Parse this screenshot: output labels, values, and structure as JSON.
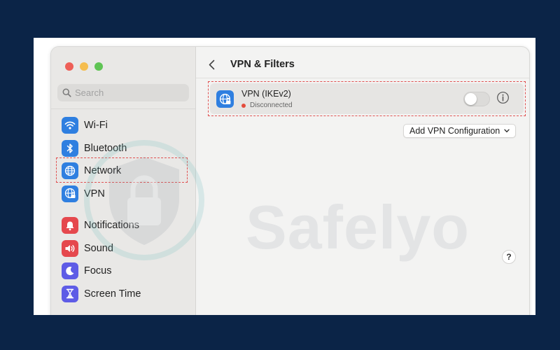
{
  "sidebar": {
    "search_placeholder": "Search",
    "items": [
      {
        "label": "Wi-Fi",
        "icon": "wifi-icon",
        "color": "#2f7fe0"
      },
      {
        "label": "Bluetooth",
        "icon": "bluetooth-icon",
        "color": "#2f7fe0"
      },
      {
        "label": "Network",
        "icon": "globe-icon",
        "color": "#2f7fe0"
      },
      {
        "label": "VPN",
        "icon": "globe-lock-icon",
        "color": "#2f7fe0"
      },
      {
        "label": "Notifications",
        "icon": "bell-icon",
        "color": "#e5484d"
      },
      {
        "label": "Sound",
        "icon": "speaker-icon",
        "color": "#e5484d"
      },
      {
        "label": "Focus",
        "icon": "moon-icon",
        "color": "#5e5ce6"
      },
      {
        "label": "Screen Time",
        "icon": "hourglass-icon",
        "color": "#5e5ce6"
      }
    ]
  },
  "main": {
    "title": "VPN & Filters",
    "vpn": {
      "name": "VPN (IKEv2)",
      "status": "Disconnected",
      "status_color": "#e44c3c",
      "enabled": false
    },
    "add_button_label": "Add VPN Configuration",
    "help_label": "?"
  },
  "watermark": {
    "text": "Safelyo"
  },
  "colors": {
    "page_background": "#0b2447",
    "highlight": "#e05252",
    "accent": "#2f7fe0"
  }
}
